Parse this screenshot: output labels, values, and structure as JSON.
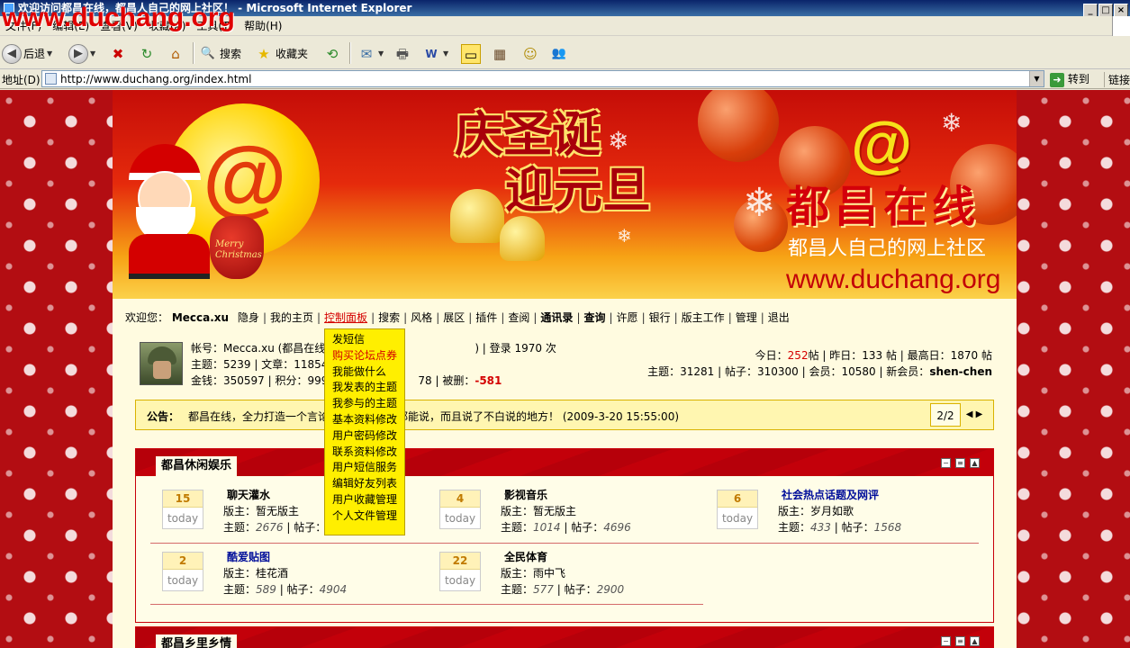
{
  "window": {
    "title": "欢迎访问都昌在线，都昌人自己的网上社区！ - Microsoft Internet Explorer",
    "watermark": "www.duchang.org",
    "min_label": "_",
    "max_label": "□",
    "close_label": "×"
  },
  "menubar": {
    "items": [
      "文件(F)",
      "编辑(E)",
      "查看(V)",
      "收藏(A)",
      "工具(T)",
      "帮助(H)"
    ]
  },
  "toolbar": {
    "back_label": "后退",
    "search_label": "搜索",
    "favorites_label": "收藏夹",
    "back_glyph": "◀",
    "forward_glyph": "▶",
    "dropdown_glyph": "▼",
    "stop_glyph": "✖",
    "refresh_glyph": "↻",
    "home_glyph": "⌂",
    "search_glyph": "🔍",
    "favorites_glyph": "★",
    "history_glyph": "⟲",
    "mail_glyph": "✉",
    "print_glyph": "🖶",
    "edit_glyph": "W",
    "discuss_glyph": "▭",
    "research_glyph": "▦",
    "messenger_glyph": "☺",
    "contacts_glyph": "👥"
  },
  "addressbar": {
    "label": "地址(D)",
    "url": "http://www.duchang.org/index.html",
    "go_label": "转到",
    "go_glyph": "➜",
    "links_label": "链接",
    "dropdown_glyph": "▼"
  },
  "banner": {
    "logo_glyph": "@",
    "headline_line1": "庆圣诞",
    "headline_line2": "迎元旦",
    "site_name": "都昌在线",
    "slogan": "都昌人自己的网上社区",
    "url": "www.duchang.org",
    "bag_text": "Merry Christmas",
    "snow_glyph": "❄"
  },
  "nav": {
    "welcome": "欢迎您：",
    "username": "Mecca.xu",
    "items": [
      {
        "label": "隐身",
        "bold": false
      },
      {
        "label": "我的主页",
        "bold": false
      },
      {
        "label": "控制面板",
        "bold": false,
        "active": true
      },
      {
        "label": "搜索",
        "bold": false
      },
      {
        "label": "风格",
        "bold": false
      },
      {
        "label": "展区",
        "bold": false
      },
      {
        "label": "插件",
        "bold": false
      },
      {
        "label": "查阅",
        "bold": false
      },
      {
        "label": "通讯录",
        "bold": true
      },
      {
        "label": "查询",
        "bold": true
      },
      {
        "label": "许愿",
        "bold": false
      },
      {
        "label": "银行",
        "bold": false
      },
      {
        "label": "版主工作",
        "bold": false
      },
      {
        "label": "管理",
        "bold": false
      },
      {
        "label": "退出",
        "bold": false
      }
    ]
  },
  "dropdown": {
    "items": [
      "发短信",
      "购买论坛点券",
      "我能做什么",
      "我发表的主题",
      "我参与的主题",
      "基本资料修改",
      "用户密码修改",
      "联系资料修改",
      "用户短信服务",
      "编辑好友列表",
      "用户收藏管理",
      "个人文件管理"
    ],
    "highlight_index": 1
  },
  "user": {
    "line1": "帐号：Mecca.xu (都昌在线管",
    "line1_tail": ") | 登录 1970 次",
    "line2": "主题：5239 | 文章：11854",
    "line3_a": "金钱：350597 | 积分：999",
    "line3_b": "78 | 被删：",
    "deleted": "-581"
  },
  "stats": {
    "today_label": "今日：",
    "today_value": "252",
    "today_unit": "帖 | 昨日：133 帖 | 最高日：1870 帖",
    "line2": "主题：31281 | 帖子：310300 | 会员：10580 | 新会员：",
    "newest_member": "shen-chen"
  },
  "notice": {
    "label": "公告：",
    "text": "都昌在线，全力打造一个言论",
    "text_tail": "话都能说，而且说了不白说的地方！   (2009-3-20 15:55:00)",
    "page": "2/2",
    "prev_glyph": "◀",
    "next_glyph": "▶"
  },
  "sections": [
    {
      "title": "都昌休闲娱乐",
      "forums": [
        {
          "today": "15",
          "today_label": "today",
          "name": "聊天灌水",
          "blue": false,
          "mod": "版主：暂无版主",
          "topics_label": "主题：",
          "topics": "2676",
          "posts_label": " | 帖子：",
          "posts": "2"
        },
        {
          "today": "4",
          "today_label": "today",
          "name": "影视音乐",
          "blue": false,
          "mod": "版主：暂无版主",
          "topics_label": "主题：",
          "topics": "1014",
          "posts_label": " | 帖子：",
          "posts": "4696"
        },
        {
          "today": "6",
          "today_label": "today",
          "name": "社会热点话题及网评",
          "blue": true,
          "mod": "版主：岁月如歌",
          "topics_label": "主题：",
          "topics": "433",
          "posts_label": " | 帖子：",
          "posts": "1568"
        },
        {
          "today": "2",
          "today_label": "today",
          "name": "酷爱贴图",
          "blue": true,
          "mod": "版主：桂花酒",
          "topics_label": "主题：",
          "topics": "589",
          "posts_label": " | 帖子：",
          "posts": "4904"
        },
        {
          "today": "22",
          "today_label": "today",
          "name": "全民体育",
          "blue": false,
          "mod": "版主：雨中飞",
          "topics_label": "主题：",
          "topics": "577",
          "posts_label": " | 帖子：",
          "posts": "2900"
        }
      ]
    },
    {
      "title": "都昌乡里乡情"
    }
  ],
  "section_ctrls": [
    "−",
    "≡",
    "▲"
  ]
}
